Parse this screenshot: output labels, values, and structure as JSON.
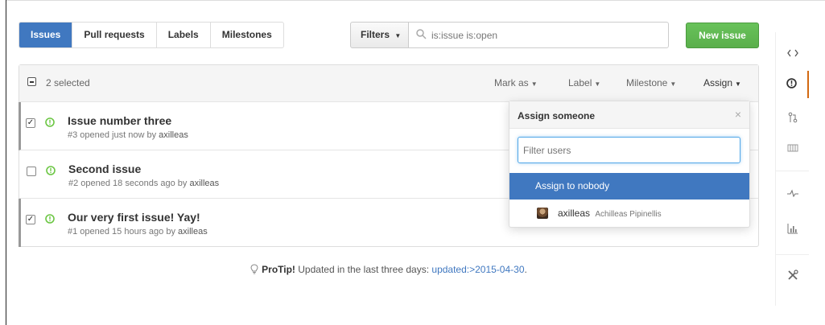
{
  "nav": {
    "tabs": [
      {
        "label": "Issues",
        "active": true
      },
      {
        "label": "Pull requests"
      },
      {
        "label": "Labels"
      },
      {
        "label": "Milestones"
      }
    ]
  },
  "toolbar": {
    "filters_label": "Filters",
    "search_value": "is:issue is:open",
    "new_issue_label": "New issue"
  },
  "list_header": {
    "selected_count": "2 selected",
    "actions": [
      "Mark as",
      "Label",
      "Milestone",
      "Assign"
    ]
  },
  "issues": [
    {
      "title": "Issue number three",
      "meta_prefix": "#3 opened just now by",
      "author": "axilleas",
      "selected": true
    },
    {
      "title": "Second issue",
      "meta_prefix": "#2 opened 18 seconds ago by",
      "author": "axilleas",
      "selected": false
    },
    {
      "title": "Our very first issue! Yay!",
      "meta_prefix": "#1 opened 15 hours ago by",
      "author": "axilleas",
      "selected": true
    }
  ],
  "assign_dropdown": {
    "title": "Assign someone",
    "filter_placeholder": "Filter users",
    "nobody_label": "Assign to nobody",
    "user": {
      "login": "axilleas",
      "full_name": "Achilleas Pipinellis"
    }
  },
  "protip": {
    "label": "ProTip!",
    "text": "Updated in the last three days:",
    "link": "updated:>2015-04-30",
    "suffix": "."
  },
  "colors": {
    "accent": "#4078c0",
    "new_issue": "#5aaf4b",
    "open_issue": "#6cc644",
    "sidebar_active": "#d26911"
  },
  "sidebar_icons": [
    "code-icon",
    "issue-opened-icon",
    "pull-request-icon",
    "wiki-icon",
    "pulse-icon",
    "graph-icon",
    "settings-icon"
  ]
}
